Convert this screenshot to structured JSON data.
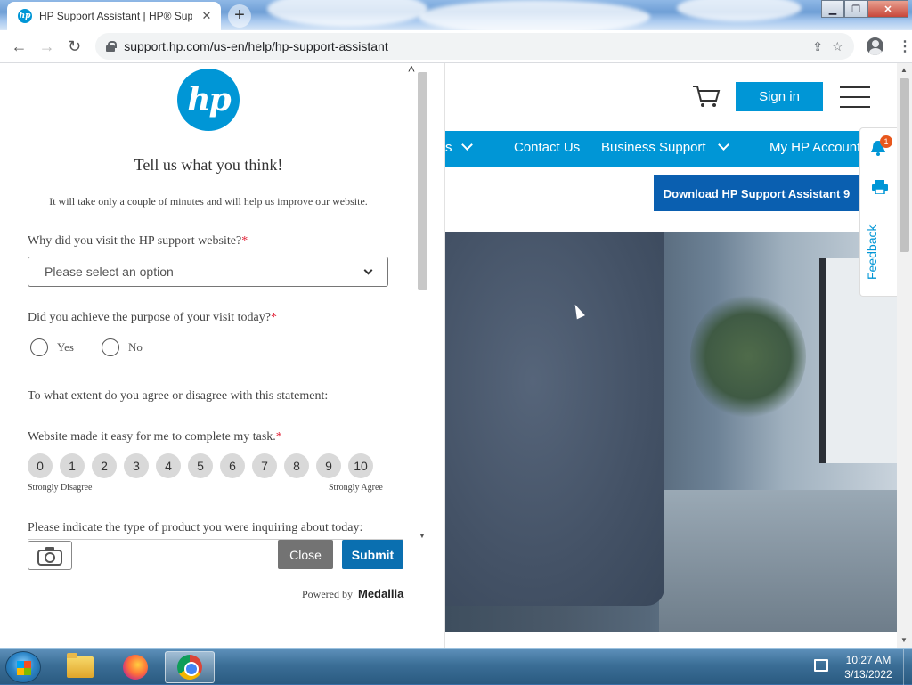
{
  "browser": {
    "tab_title": "HP Support Assistant | HP® Sup",
    "tab_favicon": "hp-logo",
    "url": "support.hp.com/us-en/help/hp-support-assistant",
    "window_controls": [
      "minimize",
      "restore",
      "close"
    ]
  },
  "survey": {
    "logo_text": "hp",
    "title": "Tell us what you think!",
    "subtitle": "It will take only a couple of minutes and will help us improve our website.",
    "q1": {
      "label": "Why did you visit the HP support website?",
      "required": "*",
      "placeholder": "Please select an option"
    },
    "q2": {
      "label": "Did you achieve the purpose of your visit today?",
      "required": "*",
      "options": [
        "Yes",
        "No"
      ]
    },
    "statement_intro": "To what extent do you agree or disagree with this statement:",
    "q3": {
      "label": "Website made it easy for me to complete my task.",
      "required": "*",
      "scale": [
        "0",
        "1",
        "2",
        "3",
        "4",
        "5",
        "6",
        "7",
        "8",
        "9",
        "10"
      ],
      "low_label": "Strongly Disagree",
      "high_label": "Strongly Agree"
    },
    "q4": {
      "label": "Please indicate the type of product you were inquiring about today:"
    },
    "close_label": "Close",
    "submit_label": "Submit",
    "powered_by": "Powered by",
    "brand": "Medallia"
  },
  "site": {
    "sign_in": "Sign in",
    "nav": {
      "partial": "s",
      "contact": "Contact Us",
      "business": "Business Support",
      "account": "My HP Account"
    },
    "download_button": "Download HP Support Assistant 9",
    "notification_count": "1",
    "feedback_tab": "Feedback"
  },
  "taskbar": {
    "time": "10:27 AM",
    "date": "3/13/2022",
    "pinned": [
      "file-explorer",
      "firefox",
      "chrome"
    ]
  },
  "colors": {
    "hp_blue": "#0096d6",
    "submit_blue": "#0a6fb0",
    "close_gray": "#737373",
    "required_red": "#e3263b"
  }
}
